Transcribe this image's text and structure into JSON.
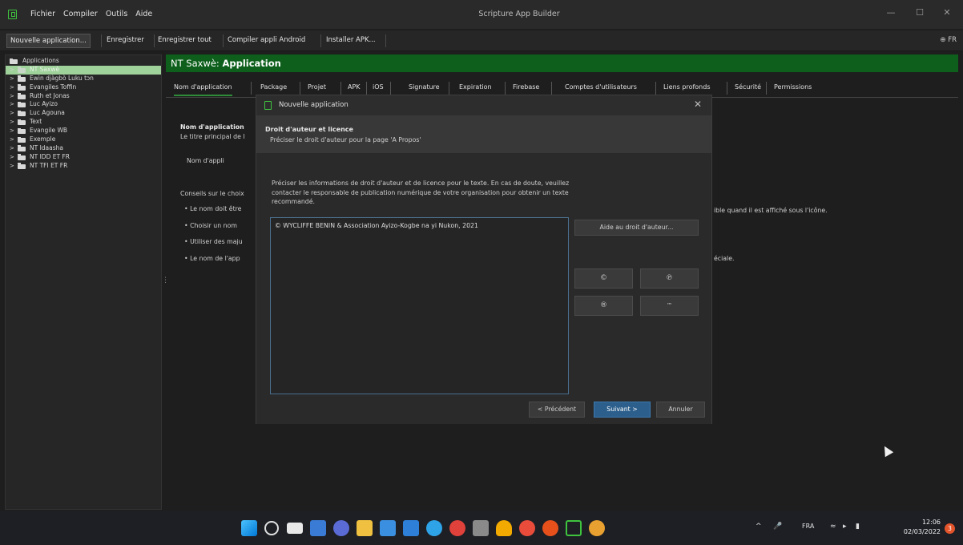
{
  "window": {
    "title": "Scripture App Builder",
    "menu": [
      "Fichier",
      "Compiler",
      "Outils",
      "Aide"
    ],
    "controls": {
      "minimize": "—",
      "maximize": "☐",
      "close": "✕"
    }
  },
  "toolbar": {
    "items": [
      "Nouvelle application...",
      "Enregistrer",
      "Enregistrer tout",
      "Compiler appli Android",
      "Installer APK..."
    ],
    "language": "⊕ FR"
  },
  "sidebar": {
    "root": "Applications",
    "items": [
      "NT Saxwè",
      "Ewìn djàgbò Luku tɔn",
      "Evangiles Toffin",
      "Ruth et Jonas",
      "Luc Ayizo",
      "Luc Agouna",
      "Text",
      "Evangile WB",
      "Exemple",
      "NT Idaasha",
      "NT IDD ET FR",
      "NT TFI ET FR"
    ],
    "selected_index": 0
  },
  "main": {
    "title_prefix": "NT Saxwè: ",
    "title_bold": "Application",
    "tabs": [
      "Nom d'application",
      "Package",
      "Projet",
      "APK",
      "iOS",
      "Signature",
      "Expiration",
      "Firebase",
      "Comptes d'utilisateurs",
      "Liens profonds",
      "Sécurité",
      "Permissions"
    ],
    "active_tab": 0,
    "content": {
      "heading": "Nom d'application",
      "subtitle": "Le titre principal de l",
      "field_label": "Nom d'appli",
      "tips_heading": "Conseils sur le choix",
      "tips": [
        "•  Le nom doit être",
        "•  Choisir un nom",
        "•  Utiliser des maju",
        "•  Le nom de l'app"
      ],
      "tip_suffix_1": "ible quand il est affiché sous l'icône.",
      "tip_suffix_4": "éciale."
    }
  },
  "dialog": {
    "title": "Nouvelle application",
    "close": "✕",
    "header_title": "Droit d'auteur et licence",
    "header_subtitle": "Préciser le droit d'auteur pour la page 'A Propos'",
    "instruction_line1": "Préciser les informations de droit d'auteur et de licence pour le texte. En cas de doute, veuillez",
    "instruction_line2": "contacter le responsable de publication numérique de votre organisation pour obtenir un texte",
    "instruction_line3": "recommandé.",
    "copyright_text": "© WYCLIFFE BENIN & Association Ayizo-Kogbe na yi Nukon, 2021",
    "help_button": "Aide au droit d'auteur...",
    "symbols": [
      "©",
      "℗",
      "®",
      "™"
    ],
    "prev_button": "< Précédent",
    "next_button": "Suivant >",
    "cancel_button": "Annuler"
  },
  "taskbar": {
    "language": "FRA",
    "time": "12:06",
    "date": "02/03/2022",
    "notification_count": "3",
    "tray_up": "^"
  }
}
